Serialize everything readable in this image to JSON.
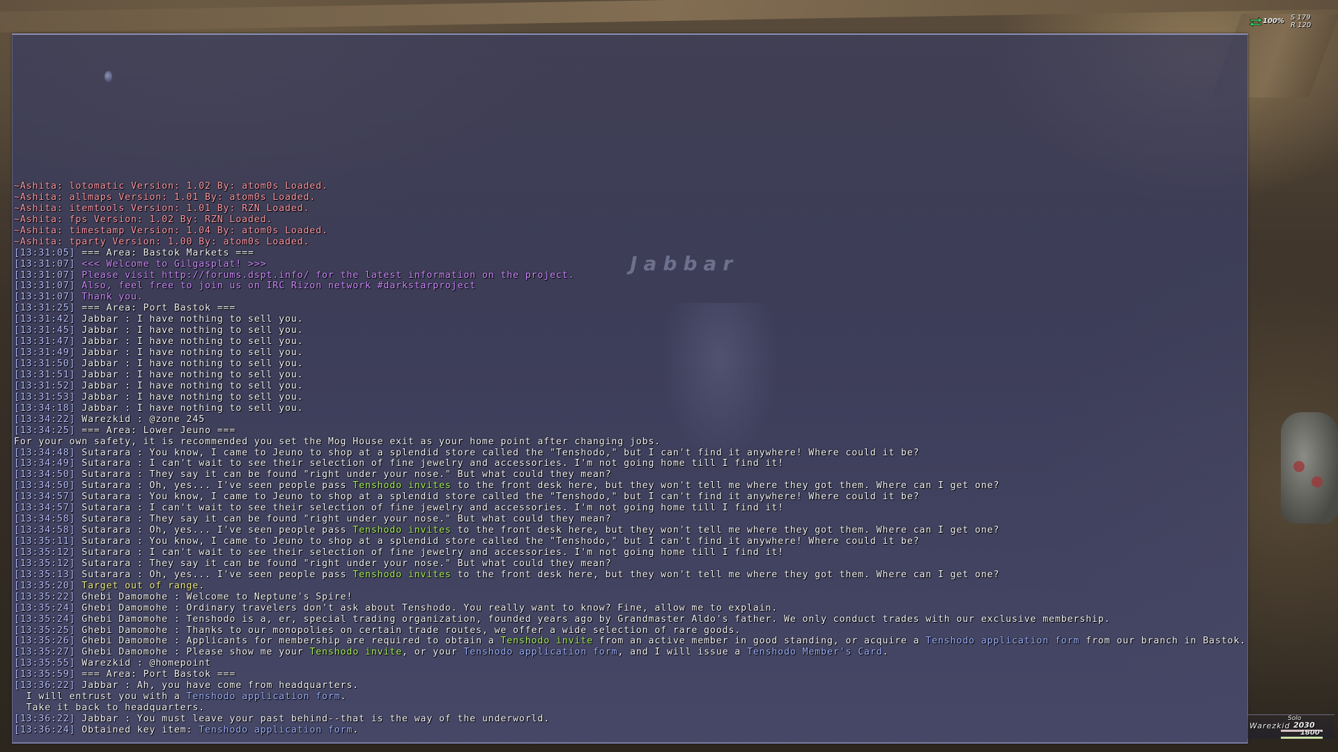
{
  "scene": {
    "npc_nameplate": "Jabbar"
  },
  "status": {
    "percent": "100%",
    "s_value": "S 179",
    "r_value": "R 120"
  },
  "party": {
    "mode": "Solo",
    "name": "Warezkid",
    "hp": "2030",
    "mp": "1800"
  },
  "colors": {
    "timestamp": "#b9c2ff",
    "addon_message": "#ff9aa5",
    "server_message": "#cf8cff",
    "system_message": "#f2f08a",
    "key_item_highlight": "#a8f05a",
    "item_link": "#9eb2ff",
    "default_text": "#f4f4f6"
  },
  "chat_lines": [
    {
      "ts": "",
      "segments": [
        {
          "t": "~Ashita: lotomatic Version: 1.02 By: atom0s Loaded.",
          "c": "pink"
        }
      ]
    },
    {
      "ts": "",
      "segments": [
        {
          "t": "~Ashita: allmaps Version: 1.01 By: atom0s Loaded.",
          "c": "pink"
        }
      ]
    },
    {
      "ts": "",
      "segments": [
        {
          "t": "~Ashita: itemtools Version: 1.01 By: RZN Loaded.",
          "c": "pink"
        }
      ]
    },
    {
      "ts": "",
      "segments": [
        {
          "t": "~Ashita: fps Version: 1.02 By: RZN Loaded.",
          "c": "pink"
        }
      ]
    },
    {
      "ts": "",
      "segments": [
        {
          "t": "~Ashita: timestamp Version: 1.04 By: atom0s Loaded.",
          "c": "pink"
        }
      ]
    },
    {
      "ts": "",
      "segments": [
        {
          "t": "~Ashita: tparty Version: 1.00 By: atom0s Loaded.",
          "c": "pink"
        }
      ]
    },
    {
      "ts": "[13:31:05]",
      "segments": [
        {
          "t": " === Area: Bastok Markets ===",
          "c": "white"
        }
      ]
    },
    {
      "ts": "[13:31:07]",
      "segments": [
        {
          "t": " <<< Welcome to Gilgasplat! >>>",
          "c": "purple"
        }
      ]
    },
    {
      "ts": "[13:31:07]",
      "segments": [
        {
          "t": " Please visit http://forums.dspt.info/ for the latest information on the project.",
          "c": "purple"
        }
      ]
    },
    {
      "ts": "[13:31:07]",
      "segments": [
        {
          "t": " Also, feel free to join us on IRC Rizon network #darkstarproject",
          "c": "purple"
        }
      ]
    },
    {
      "ts": "[13:31:07]",
      "segments": [
        {
          "t": " Thank you.",
          "c": "purple"
        }
      ]
    },
    {
      "ts": "[13:31:25]",
      "segments": [
        {
          "t": " === Area: Port Bastok ===",
          "c": "white"
        }
      ]
    },
    {
      "ts": "[13:31:42]",
      "segments": [
        {
          "t": " Jabbar : I have nothing to sell you.",
          "c": "white"
        }
      ]
    },
    {
      "ts": "[13:31:45]",
      "segments": [
        {
          "t": " Jabbar : I have nothing to sell you.",
          "c": "white"
        }
      ]
    },
    {
      "ts": "[13:31:47]",
      "segments": [
        {
          "t": " Jabbar : I have nothing to sell you.",
          "c": "white"
        }
      ]
    },
    {
      "ts": "[13:31:49]",
      "segments": [
        {
          "t": " Jabbar : I have nothing to sell you.",
          "c": "white"
        }
      ]
    },
    {
      "ts": "[13:31:50]",
      "segments": [
        {
          "t": " Jabbar : I have nothing to sell you.",
          "c": "white"
        }
      ]
    },
    {
      "ts": "[13:31:51]",
      "segments": [
        {
          "t": " Jabbar : I have nothing to sell you.",
          "c": "white"
        }
      ]
    },
    {
      "ts": "[13:31:52]",
      "segments": [
        {
          "t": " Jabbar : I have nothing to sell you.",
          "c": "white"
        }
      ]
    },
    {
      "ts": "[13:31:53]",
      "segments": [
        {
          "t": " Jabbar : I have nothing to sell you.",
          "c": "white"
        }
      ]
    },
    {
      "ts": "[13:34:18]",
      "segments": [
        {
          "t": " Jabbar : I have nothing to sell you.",
          "c": "white"
        }
      ]
    },
    {
      "ts": "[13:34:22]",
      "segments": [
        {
          "t": " Warezkid : @zone 245",
          "c": "white"
        }
      ]
    },
    {
      "ts": "[13:34:25]",
      "segments": [
        {
          "t": " === Area: Lower Jeuno ===",
          "c": "white"
        }
      ]
    },
    {
      "ts": "",
      "segments": [
        {
          "t": "For your own safety, it is recommended you set the Mog House exit as your home point after changing jobs.",
          "c": "white"
        }
      ]
    },
    {
      "ts": "[13:34:48]",
      "segments": [
        {
          "t": " Sutarara : You know, I came to Jeuno to shop at a splendid store called the \"Tenshodo,\" but I can't find it anywhere! Where could it be?",
          "c": "white"
        }
      ]
    },
    {
      "ts": "[13:34:49]",
      "segments": [
        {
          "t": " Sutarara : I can't wait to see their selection of fine jewelry and accessories. I'm not going home till I find it!",
          "c": "white"
        }
      ]
    },
    {
      "ts": "[13:34:50]",
      "segments": [
        {
          "t": " Sutarara : They say it can be found \"right under your nose.\" But what could they mean?",
          "c": "white"
        }
      ]
    },
    {
      "ts": "[13:34:50]",
      "segments": [
        {
          "t": " Sutarara : Oh, yes... I've seen people pass ",
          "c": "white"
        },
        {
          "t": "Tenshodo invites",
          "c": "green"
        },
        {
          "t": " to the front desk here, but they won't tell me where they got them. Where can I get one?",
          "c": "white"
        }
      ]
    },
    {
      "ts": "[13:34:57]",
      "segments": [
        {
          "t": " Sutarara : You know, I came to Jeuno to shop at a splendid store called the \"Tenshodo,\" but I can't find it anywhere! Where could it be?",
          "c": "white"
        }
      ]
    },
    {
      "ts": "[13:34:57]",
      "segments": [
        {
          "t": " Sutarara : I can't wait to see their selection of fine jewelry and accessories. I'm not going home till I find it!",
          "c": "white"
        }
      ]
    },
    {
      "ts": "[13:34:58]",
      "segments": [
        {
          "t": " Sutarara : They say it can be found \"right under your nose.\" But what could they mean?",
          "c": "white"
        }
      ]
    },
    {
      "ts": "[13:34:58]",
      "segments": [
        {
          "t": " Sutarara : Oh, yes... I've seen people pass ",
          "c": "white"
        },
        {
          "t": "Tenshodo invites",
          "c": "green"
        },
        {
          "t": " to the front desk here, but they won't tell me where they got them. Where can I get one?",
          "c": "white"
        }
      ]
    },
    {
      "ts": "[13:35:11]",
      "segments": [
        {
          "t": " Sutarara : You know, I came to Jeuno to shop at a splendid store called the \"Tenshodo,\" but I can't find it anywhere! Where could it be?",
          "c": "white"
        }
      ]
    },
    {
      "ts": "[13:35:12]",
      "segments": [
        {
          "t": " Sutarara : I can't wait to see their selection of fine jewelry and accessories. I'm not going home till I find it!",
          "c": "white"
        }
      ]
    },
    {
      "ts": "[13:35:12]",
      "segments": [
        {
          "t": " Sutarara : They say it can be found \"right under your nose.\" But what could they mean?",
          "c": "white"
        }
      ]
    },
    {
      "ts": "[13:35:13]",
      "segments": [
        {
          "t": " Sutarara : Oh, yes... I've seen people pass ",
          "c": "white"
        },
        {
          "t": "Tenshodo invites",
          "c": "green"
        },
        {
          "t": " to the front desk here, but they won't tell me where they got them. Where can I get one?",
          "c": "white"
        }
      ]
    },
    {
      "ts": "[13:35:20]",
      "segments": [
        {
          "t": " Target out of range.",
          "c": "yellow"
        }
      ]
    },
    {
      "ts": "[13:35:22]",
      "segments": [
        {
          "t": " Ghebi Damomohe : Welcome to Neptune's Spire!",
          "c": "white"
        }
      ]
    },
    {
      "ts": "[13:35:24]",
      "segments": [
        {
          "t": " Ghebi Damomohe : Ordinary travelers don't ask about Tenshodo. You really want to know? Fine, allow me to explain.",
          "c": "white"
        }
      ]
    },
    {
      "ts": "[13:35:24]",
      "segments": [
        {
          "t": " Ghebi Damomohe : Tenshodo is a, er, special trading organization, founded years ago by Grandmaster Aldo's father. We only conduct trades with our exclusive membership.",
          "c": "white"
        }
      ]
    },
    {
      "ts": "[13:35:25]",
      "segments": [
        {
          "t": " Ghebi Damomohe : Thanks to our monopolies on certain trade routes, we offer a wide selection of rare goods.",
          "c": "white"
        }
      ]
    },
    {
      "ts": "[13:35:26]",
      "segments": [
        {
          "t": " Ghebi Damomohe : Applicants for membership are required to obtain a ",
          "c": "white"
        },
        {
          "t": "Tenshodo invite",
          "c": "green"
        },
        {
          "t": " from an active member in good standing, or acquire a ",
          "c": "white"
        },
        {
          "t": "Tenshodo application form",
          "c": "blue"
        },
        {
          "t": " from our branch in Bastok.",
          "c": "white"
        }
      ]
    },
    {
      "ts": "[13:35:27]",
      "segments": [
        {
          "t": " Ghebi Damomohe : Please show me your ",
          "c": "white"
        },
        {
          "t": "Tenshodo invite",
          "c": "green"
        },
        {
          "t": ", or your ",
          "c": "white"
        },
        {
          "t": "Tenshodo application form",
          "c": "blue"
        },
        {
          "t": ", and I will issue a ",
          "c": "white"
        },
        {
          "t": "Tenshodo Member's Card",
          "c": "blue"
        },
        {
          "t": ".",
          "c": "white"
        }
      ]
    },
    {
      "ts": "[13:35:55]",
      "segments": [
        {
          "t": " Warezkid : @homepoint",
          "c": "white"
        }
      ]
    },
    {
      "ts": "[13:35:59]",
      "segments": [
        {
          "t": " === Area: Port Bastok ===",
          "c": "white"
        }
      ]
    },
    {
      "ts": "[13:36:22]",
      "segments": [
        {
          "t": " Jabbar : Ah, you have come from headquarters.",
          "c": "white"
        }
      ]
    },
    {
      "ts": "",
      "segments": [
        {
          "t": "  I will entrust you with a ",
          "c": "white"
        },
        {
          "t": "Tenshodo application form",
          "c": "blue"
        },
        {
          "t": ".",
          "c": "white"
        }
      ]
    },
    {
      "ts": "",
      "segments": [
        {
          "t": "  Take it back to headquarters.",
          "c": "white"
        }
      ]
    },
    {
      "ts": "[13:36:22]",
      "segments": [
        {
          "t": " Jabbar : You must leave your past behind--that is the way of the underworld.",
          "c": "white"
        }
      ]
    },
    {
      "ts": "[13:36:24]",
      "segments": [
        {
          "t": " Obtained key item: ",
          "c": "white"
        },
        {
          "t": "Tenshodo application form",
          "c": "blue"
        },
        {
          "t": ".",
          "c": "white"
        }
      ]
    }
  ]
}
